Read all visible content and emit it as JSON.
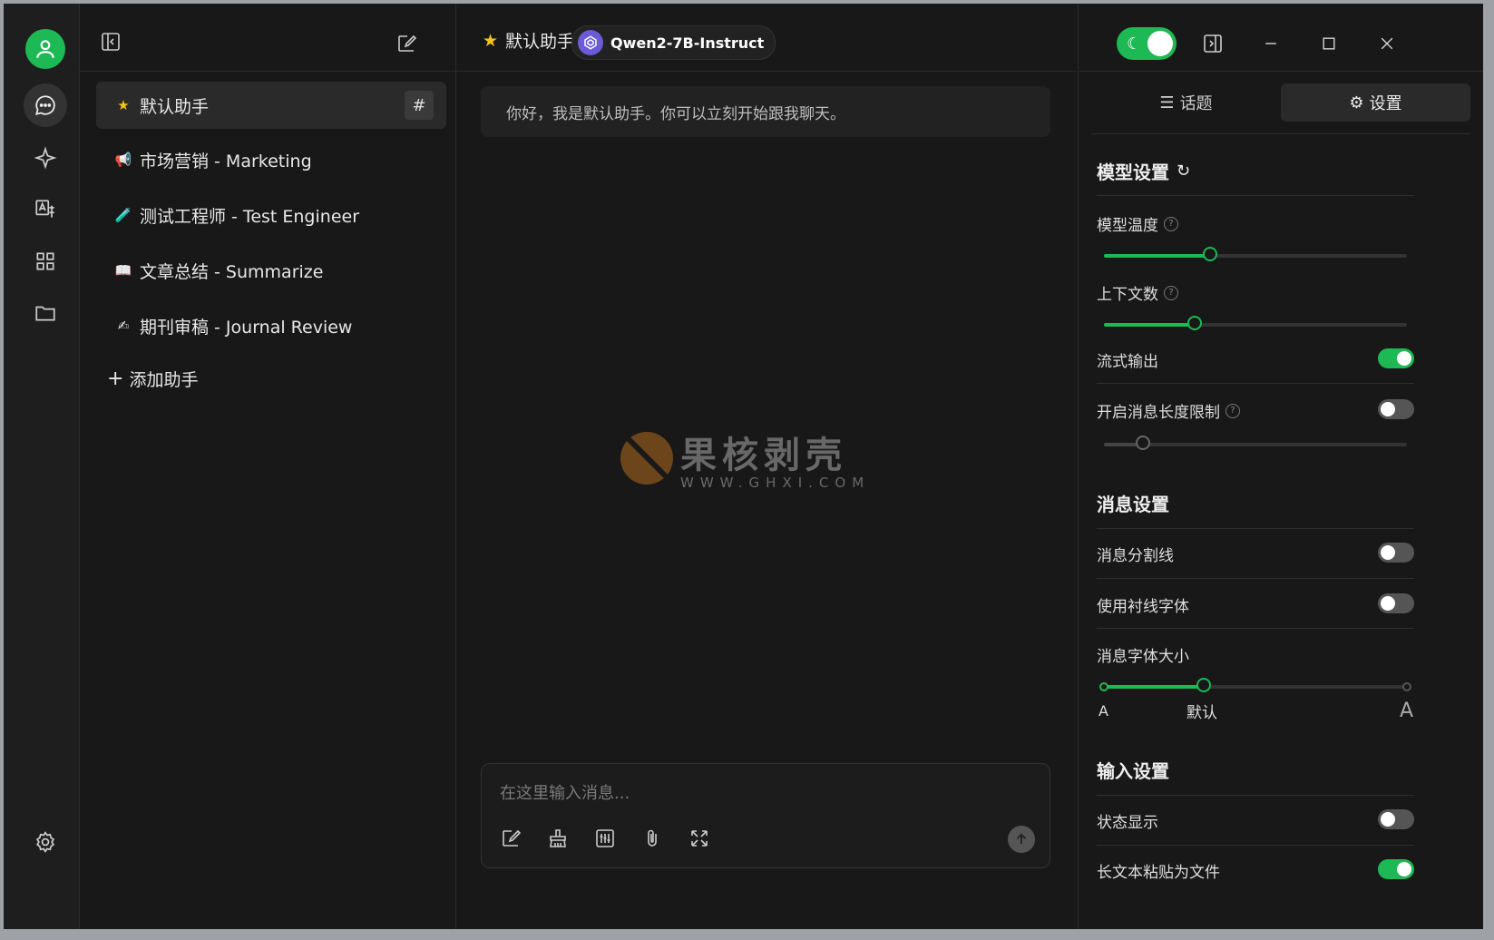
{
  "header": {
    "assistant_star": "★",
    "assistant_name": "默认助手",
    "model_name": "Qwen2-7B-Instruct"
  },
  "assistants": {
    "items": [
      {
        "emoji": "★",
        "label": "默认助手",
        "active": true,
        "hash": "#"
      },
      {
        "emoji": "📢",
        "label": "市场营销 - Marketing"
      },
      {
        "emoji": "🧪",
        "label": "测试工程师 - Test Engineer"
      },
      {
        "emoji": "📖",
        "label": "文章总结 - Summarize"
      },
      {
        "emoji": "✍",
        "label": "期刊审稿 - Journal Review"
      }
    ],
    "add_label": "添加助手",
    "add_icon": "+"
  },
  "chat": {
    "greeting": "你好，我是默认助手。你可以立刻开始跟我聊天。",
    "input_placeholder": "在这里输入消息..."
  },
  "watermark": {
    "main": "果核剥壳",
    "sub": "WWW.GHXI.COM"
  },
  "panel": {
    "tab_topics": "话题",
    "tab_settings": "设置",
    "model_settings": {
      "title": "模型设置",
      "temperature_label": "模型温度",
      "temperature_level": 0.35,
      "context_label": "上下文数",
      "context_level": 0.3,
      "stream_label": "流式输出",
      "stream_on": true,
      "max_len_label": "开启消息长度限制",
      "max_len_on": false,
      "max_len_level": 0.13
    },
    "message_settings": {
      "title": "消息设置",
      "divider_label": "消息分割线",
      "divider_on": false,
      "serif_label": "使用衬线字体",
      "serif_on": false,
      "font_size_label": "消息字体大小",
      "font_size_level": 0.33,
      "font_small": "A",
      "font_default": "默认",
      "font_large": "A"
    },
    "input_settings": {
      "title": "输入设置",
      "status_label": "状态显示",
      "status_on": false,
      "paste_label": "长文本粘贴为文件",
      "paste_on": true
    }
  },
  "colors": {
    "accent": "#1db954",
    "background": "#181818",
    "panel": "#1e1e1e"
  }
}
